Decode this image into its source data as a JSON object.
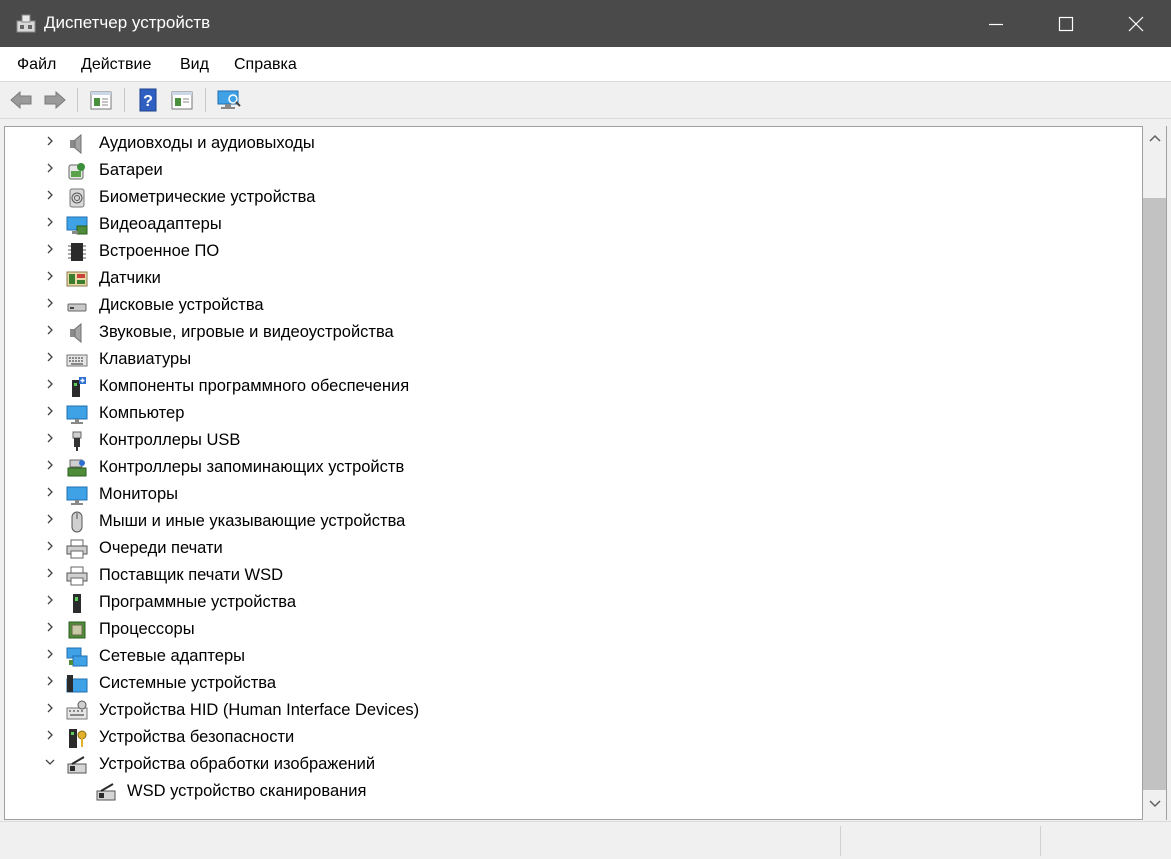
{
  "window": {
    "title": "Диспетчер устройств",
    "icons": {
      "app": "device-manager-icon",
      "minimize": "minimize-icon",
      "maximize": "maximize-icon",
      "close": "close-icon"
    }
  },
  "menu": {
    "file": "Файл",
    "action": "Действие",
    "view": "Вид",
    "help": "Справка"
  },
  "toolbar": [
    "back-arrow-icon",
    "forward-arrow-icon",
    "properties-icon",
    "help-icon",
    "update-driver-icon",
    "scan-hardware-icon"
  ],
  "tree": {
    "categories": [
      {
        "label": "Аудиовходы и аудиовыходы",
        "icon": "speaker-icon",
        "expanded": false
      },
      {
        "label": "Батареи",
        "icon": "battery-icon",
        "expanded": false
      },
      {
        "label": "Биометрические устройства",
        "icon": "fingerprint-icon",
        "expanded": false
      },
      {
        "label": "Видеоадаптеры",
        "icon": "display-adapter-icon",
        "expanded": false
      },
      {
        "label": "Встроенное ПО",
        "icon": "firmware-chip-icon",
        "expanded": false
      },
      {
        "label": "Датчики",
        "icon": "sensor-icon",
        "expanded": false
      },
      {
        "label": "Дисковые устройства",
        "icon": "disk-drive-icon",
        "expanded": false
      },
      {
        "label": "Звуковые, игровые и видеоустройства",
        "icon": "speaker-icon",
        "expanded": false
      },
      {
        "label": "Клавиатуры",
        "icon": "keyboard-icon",
        "expanded": false
      },
      {
        "label": "Компоненты программного обеспечения",
        "icon": "software-component-icon",
        "expanded": false
      },
      {
        "label": "Компьютер",
        "icon": "monitor-icon",
        "expanded": false
      },
      {
        "label": "Контроллеры USB",
        "icon": "usb-icon",
        "expanded": false
      },
      {
        "label": "Контроллеры запоминающих устройств",
        "icon": "storage-controller-icon",
        "expanded": false
      },
      {
        "label": "Мониторы",
        "icon": "monitor-icon",
        "expanded": false
      },
      {
        "label": "Мыши и иные указывающие устройства",
        "icon": "mouse-icon",
        "expanded": false
      },
      {
        "label": "Очереди печати",
        "icon": "printer-icon",
        "expanded": false
      },
      {
        "label": "Поставщик печати WSD",
        "icon": "printer-icon",
        "expanded": false
      },
      {
        "label": "Программные устройства",
        "icon": "software-device-icon",
        "expanded": false
      },
      {
        "label": "Процессоры",
        "icon": "processor-icon",
        "expanded": false
      },
      {
        "label": "Сетевые адаптеры",
        "icon": "network-adapter-icon",
        "expanded": false
      },
      {
        "label": "Системные устройства",
        "icon": "system-device-icon",
        "expanded": false
      },
      {
        "label": "Устройства HID (Human Interface Devices)",
        "icon": "hid-icon",
        "expanded": false
      },
      {
        "label": "Устройства безопасности",
        "icon": "security-key-icon",
        "expanded": false
      },
      {
        "label": "Устройства обработки изображений",
        "icon": "camera-icon",
        "expanded": true,
        "children": [
          {
            "label": "WSD устройство сканирования",
            "icon": "scanner-icon"
          }
        ]
      }
    ]
  },
  "scrollbar": {
    "up": "scroll-up-arrow-icon",
    "down": "scroll-down-arrow-icon"
  }
}
